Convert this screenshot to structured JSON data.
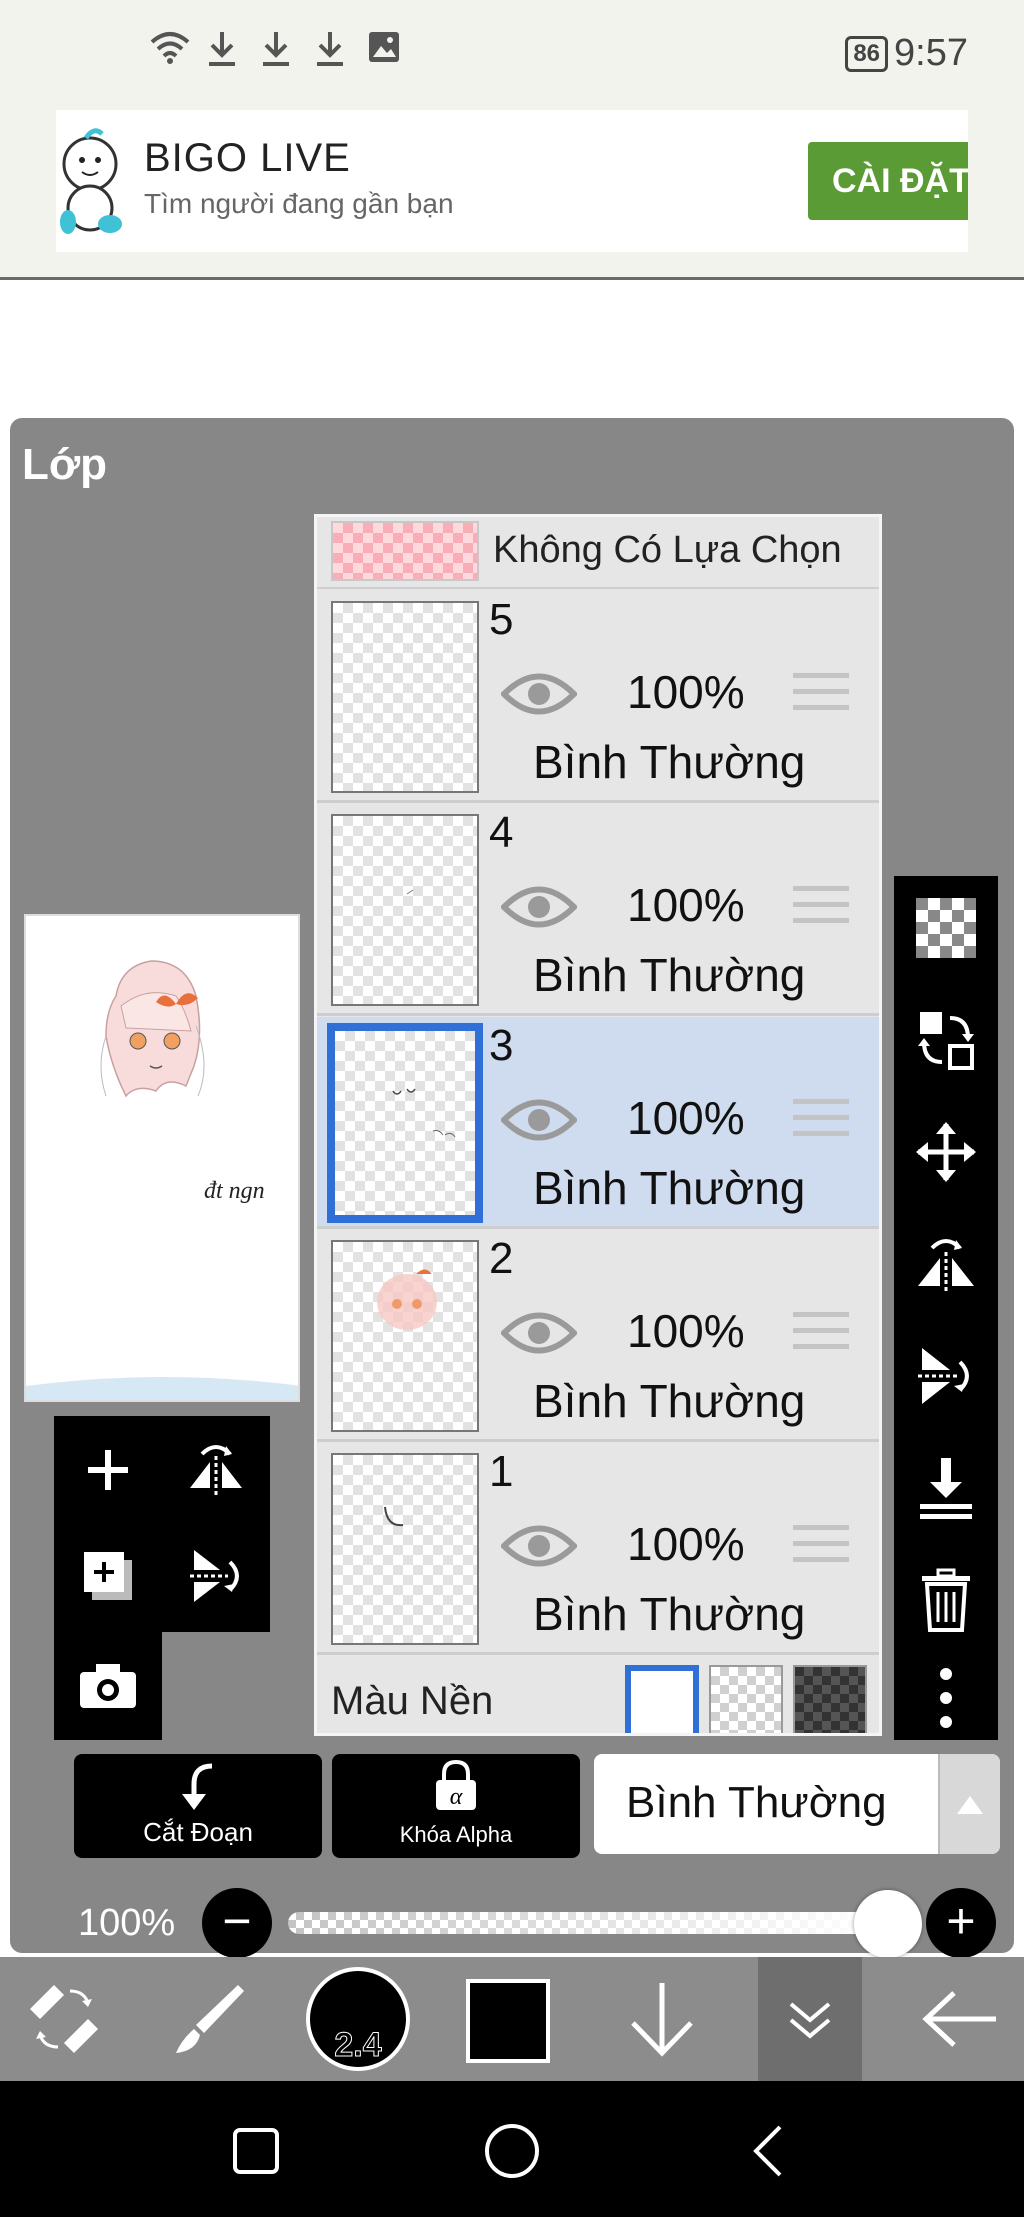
{
  "status_bar": {
    "battery": "86",
    "time": "9:57",
    "icons": [
      "wifi-icon",
      "download-icon",
      "download-icon",
      "download-icon",
      "image-icon"
    ]
  },
  "ad": {
    "title": "BIGO LIVE",
    "subtitle": "Tìm người đang gần bạn",
    "button": "CÀI ĐẶT",
    "button_color": "#5a9b36"
  },
  "panel": {
    "title": "Lớp",
    "selection_layer": "Không Có Lựa Chọn",
    "layers": [
      {
        "number": "5",
        "opacity": "100%",
        "mode": "Bình Thường",
        "selected": false
      },
      {
        "number": "4",
        "opacity": "100%",
        "mode": "Bình Thường",
        "selected": false
      },
      {
        "number": "3",
        "opacity": "100%",
        "mode": "Bình Thường",
        "selected": true
      },
      {
        "number": "2",
        "opacity": "100%",
        "mode": "Bình Thường",
        "selected": false
      },
      {
        "number": "1",
        "opacity": "100%",
        "mode": "Bình Thường",
        "selected": false
      }
    ],
    "background_label": "Màu Nền",
    "canvas_signature": "đt ngn",
    "clip_button": "Cắt Đoạn",
    "alpha_lock_button": "Khóa Alpha",
    "blend_mode": "Bình Thường",
    "opacity_label": "100%",
    "opacity_value": 1.0,
    "selected_highlight": "#cfdbee",
    "selected_border": "#2f6fd6"
  },
  "toolbar": {
    "brush_size": "2.4",
    "color": "#000000"
  }
}
